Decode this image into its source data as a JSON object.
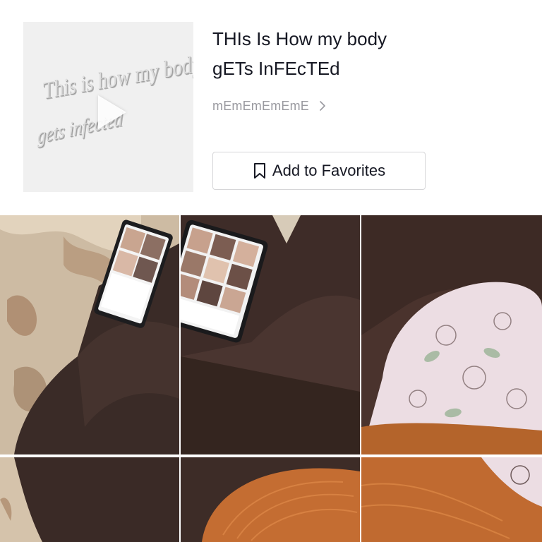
{
  "sound": {
    "cover_text_line1": "This is how my body",
    "cover_text_line2": "gets infected",
    "title_line1": "THIs Is How my body",
    "title_line2": "gETs InFEcTEd",
    "author": "mEmEmEmEmE",
    "favorite_label": "Add to Favorites"
  },
  "icons": {
    "play": "play-icon",
    "chevron": "chevron-right-icon",
    "bookmark": "bookmark-icon"
  },
  "colors": {
    "title": "#161823",
    "author": "#9a9aa0",
    "button_border": "#d6d6d8"
  },
  "videos": [
    {
      "id": "video-1"
    },
    {
      "id": "video-2"
    },
    {
      "id": "video-3"
    },
    {
      "id": "video-4"
    },
    {
      "id": "video-5"
    },
    {
      "id": "video-6"
    }
  ]
}
